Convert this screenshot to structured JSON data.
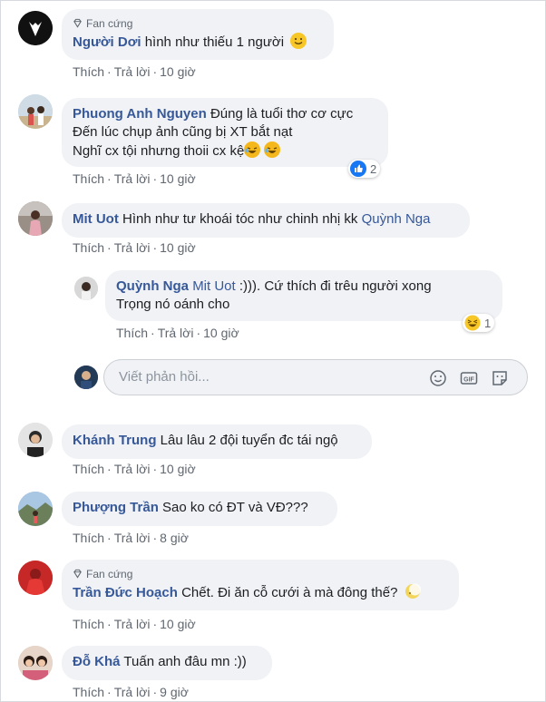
{
  "comments": [
    {
      "badge": "Fan cứng",
      "name": "Người Dơi",
      "text": "hình như thiếu 1 người",
      "like": "Thích",
      "reply": "Trả lời",
      "time": "10 giờ"
    },
    {
      "name": "Phuong Anh Nguyen",
      "text1": "Đúng là tuổi thơ cơ cực",
      "text2": "Đến lúc chụp ảnh cũng bị XT bắt nạt",
      "text3": "Nghĩ cx tội nhưng thoii cx kệ",
      "reaction_count": "2",
      "like": "Thích",
      "reply": "Trả lời",
      "time": "10 giờ"
    },
    {
      "name": "Mit Uot",
      "text": "Hình như tư khoái tóc như chinh nhị kk",
      "mention": "Quỳnh Nga",
      "like": "Thích",
      "reply": "Trả lời",
      "time": "10 giờ"
    },
    {
      "name": "Khánh Trung",
      "text": "Lâu lâu 2 đội tuyển đc tái ngộ",
      "like": "Thích",
      "reply": "Trả lời",
      "time": "10 giờ"
    },
    {
      "name": "Phượng Trần",
      "text": "Sao ko có ĐT và VĐ???",
      "like": "Thích",
      "reply": "Trả lời",
      "time": "8 giờ"
    },
    {
      "badge": "Fan cứng",
      "name": "Trần Đức Hoạch",
      "text": "Chết. Đi ăn cỗ cưới à mà đông thế?",
      "like": "Thích",
      "reply": "Trả lời",
      "time": "10 giờ"
    },
    {
      "name": "Đỗ Khá",
      "text": "Tuấn anh đâu mn :))",
      "like": "Thích",
      "reply": "Trả lời",
      "time": "9 giờ"
    }
  ],
  "nested_reply": {
    "name": "Quỳnh Nga",
    "mention": "Mit Uot",
    "text1": ":))). Cứ thích đi trêu người xong",
    "text2": "Trọng nó oánh cho",
    "reaction_count": "1",
    "like": "Thích",
    "reply": "Trả lời",
    "time": "10 giờ"
  },
  "reply_input": {
    "placeholder": "Viết phản hồi..."
  },
  "colors": {
    "name": "#365899",
    "bubble": "#f0f2f5",
    "meta": "#606770",
    "like_blue": "#1877f2"
  }
}
